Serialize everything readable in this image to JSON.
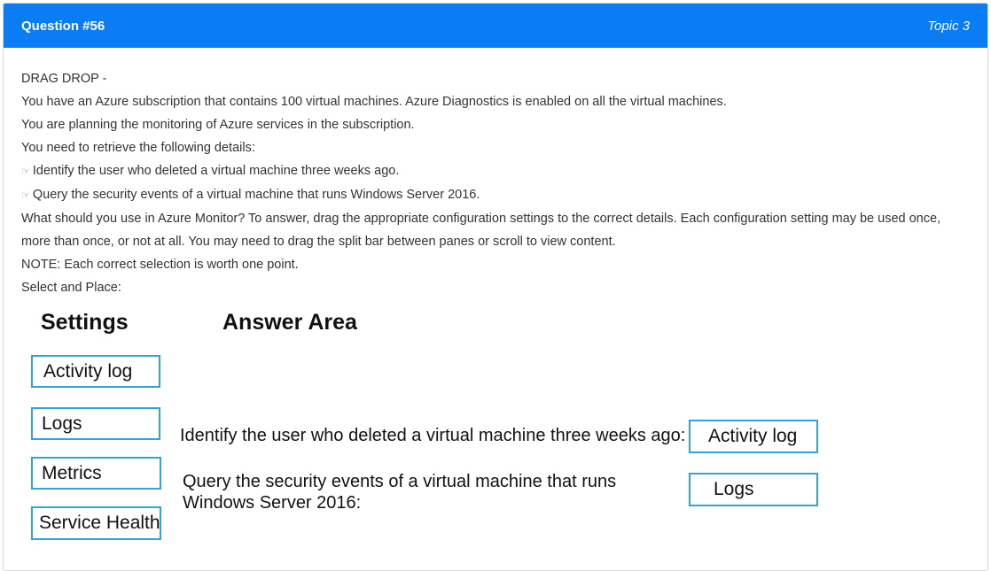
{
  "header": {
    "question": "Question #56",
    "topic": "Topic 3"
  },
  "question_text": {
    "line1": "DRAG DROP -",
    "line2": "You have an Azure subscription that contains 100 virtual machines. Azure Diagnostics is enabled on all the virtual machines.",
    "line3": "You are planning the monitoring of Azure services in the subscription.",
    "line4": "You need to retrieve the following details:",
    "bullet1": "Identify the user who deleted a virtual machine three weeks ago.",
    "bullet2": "Query the security events of a virtual machine that runs Windows Server 2016.",
    "line5": "What should you use in Azure Monitor? To answer, drag the appropriate configuration settings to the correct details. Each configuration setting may be used once, more than once, or not at all. You may need to drag the split bar between panes or scroll to view content.",
    "line6": "NOTE: Each correct selection is worth one point.",
    "line7": "Select and Place:"
  },
  "bullet_icon": "hand-pointing-icon",
  "exhibit": {
    "settings_heading": "Settings",
    "answer_heading": "Answer Area",
    "settings": [
      "Activity log",
      "Logs",
      "Metrics",
      "Service Health"
    ],
    "details": [
      {
        "label": "Identify the user who deleted a virtual machine three weeks ago:",
        "answer": "Activity log"
      },
      {
        "label_line1": "Query the security events of a virtual machine that runs",
        "label_line2": "Windows Server 2016:",
        "answer": "Logs"
      }
    ]
  },
  "colors": {
    "header_bg": "#0a7df5",
    "tile_border": "#2fa6d6"
  }
}
